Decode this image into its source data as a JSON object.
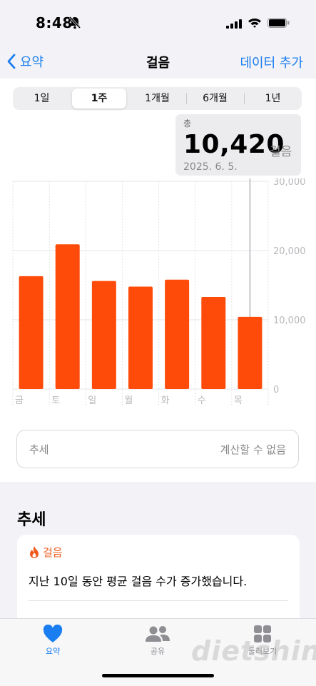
{
  "status": {
    "time": "8:48"
  },
  "nav": {
    "back_label": "요약",
    "title": "걸음",
    "action_label": "데이터 추가"
  },
  "segments": [
    "1일",
    "1주",
    "1개월",
    "6개월",
    "1년"
  ],
  "segment_selected": "1주",
  "tooltip": {
    "label": "총",
    "value": "10,420",
    "unit": "걸음",
    "date": "2025. 6. 5."
  },
  "chart_data": {
    "type": "bar",
    "categories": [
      "금",
      "토",
      "일",
      "월",
      "화",
      "수",
      "목"
    ],
    "series": [
      {
        "values": [
          16300,
          20900,
          15600,
          14800,
          15800,
          13300,
          10420
        ]
      }
    ],
    "ylim": [
      0,
      30000
    ],
    "yticks": [
      "30,000",
      "20,000",
      "10,000",
      "0"
    ],
    "grid": true,
    "selected_index": 6,
    "bar_color": "#ff4b0a"
  },
  "trend_box": {
    "label": "추세",
    "value": "계산할 수 없음"
  },
  "trend_section": {
    "title": "추세",
    "card_label": "걸음",
    "card_text": "지난 10일 동안 평균 걸음 수가 증가했습니다."
  },
  "tabs": [
    {
      "label": "요약",
      "icon": "heart-icon",
      "active": true
    },
    {
      "label": "공유",
      "icon": "people-icon",
      "active": false
    },
    {
      "label": "둘러보기",
      "icon": "grid-icon",
      "active": false
    }
  ],
  "watermark": "dietshin.com",
  "colors": {
    "accent": "#1a7ef0",
    "bar": "#ff4b0a",
    "trend_orange": "#f05a1c"
  }
}
